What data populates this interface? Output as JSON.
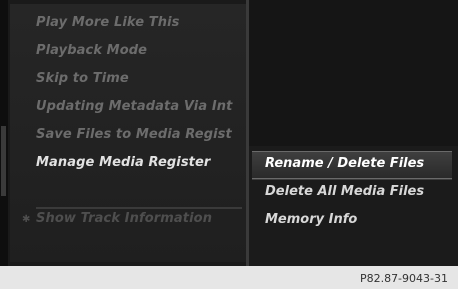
{
  "left_menu": {
    "items": [
      {
        "label": "Play More Like This"
      },
      {
        "label": "Playback Mode"
      },
      {
        "label": "Skip to Time"
      },
      {
        "label": "Updating Metadata Via Int"
      },
      {
        "label": "Save Files to Media Regist"
      },
      {
        "label": "Manage Media Register"
      }
    ],
    "footer_item": {
      "label": "Show Track Information",
      "marker": "✱"
    }
  },
  "submenu": {
    "items": [
      {
        "label": "Rename / Delete Files"
      },
      {
        "label": "Delete All Media Files"
      },
      {
        "label": "Memory Info"
      }
    ]
  },
  "caption": "P82.87-9043-31"
}
